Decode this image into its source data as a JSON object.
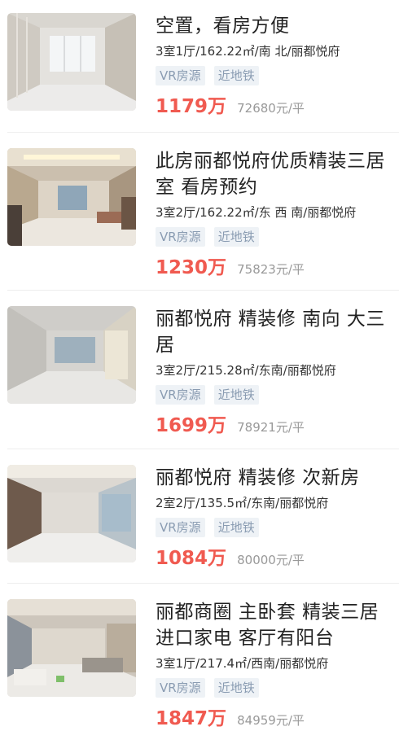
{
  "listings": [
    {
      "title": "空置，看房方便",
      "meta": "3室1厅/162.22㎡/南 北/丽都悦府",
      "tags": [
        "VR房源",
        "近地铁"
      ],
      "total_price": "1179万",
      "unit_price": "72680元/平"
    },
    {
      "title": "此房丽都悦府优质精装三居室 看房预约",
      "meta": "3室2厅/162.22㎡/东 西 南/丽都悦府",
      "tags": [
        "VR房源",
        "近地铁"
      ],
      "total_price": "1230万",
      "unit_price": "75823元/平"
    },
    {
      "title": "丽都悦府 精装修 南向 大三居",
      "meta": "3室2厅/215.28㎡/东南/丽都悦府",
      "tags": [
        "VR房源",
        "近地铁"
      ],
      "total_price": "1699万",
      "unit_price": "78921元/平"
    },
    {
      "title": "丽都悦府 精装修 次新房",
      "meta": "2室2厅/135.5㎡/东南/丽都悦府",
      "tags": [
        "VR房源",
        "近地铁"
      ],
      "total_price": "1084万",
      "unit_price": "80000元/平"
    },
    {
      "title": "丽都商圈 主卧套 精装三居 进口家电 客厅有阳台",
      "meta": "3室1厅/217.4㎡/西南/丽都悦府",
      "tags": [
        "VR房源",
        "近地铁"
      ],
      "total_price": "1847万",
      "unit_price": "84959元/平"
    }
  ],
  "colors": {
    "price": "#f05a50",
    "tag_bg": "#eef2f6",
    "tag_text": "#8a9cb2",
    "divider": "#eeeeee"
  },
  "icons": [
    "room-photo"
  ]
}
